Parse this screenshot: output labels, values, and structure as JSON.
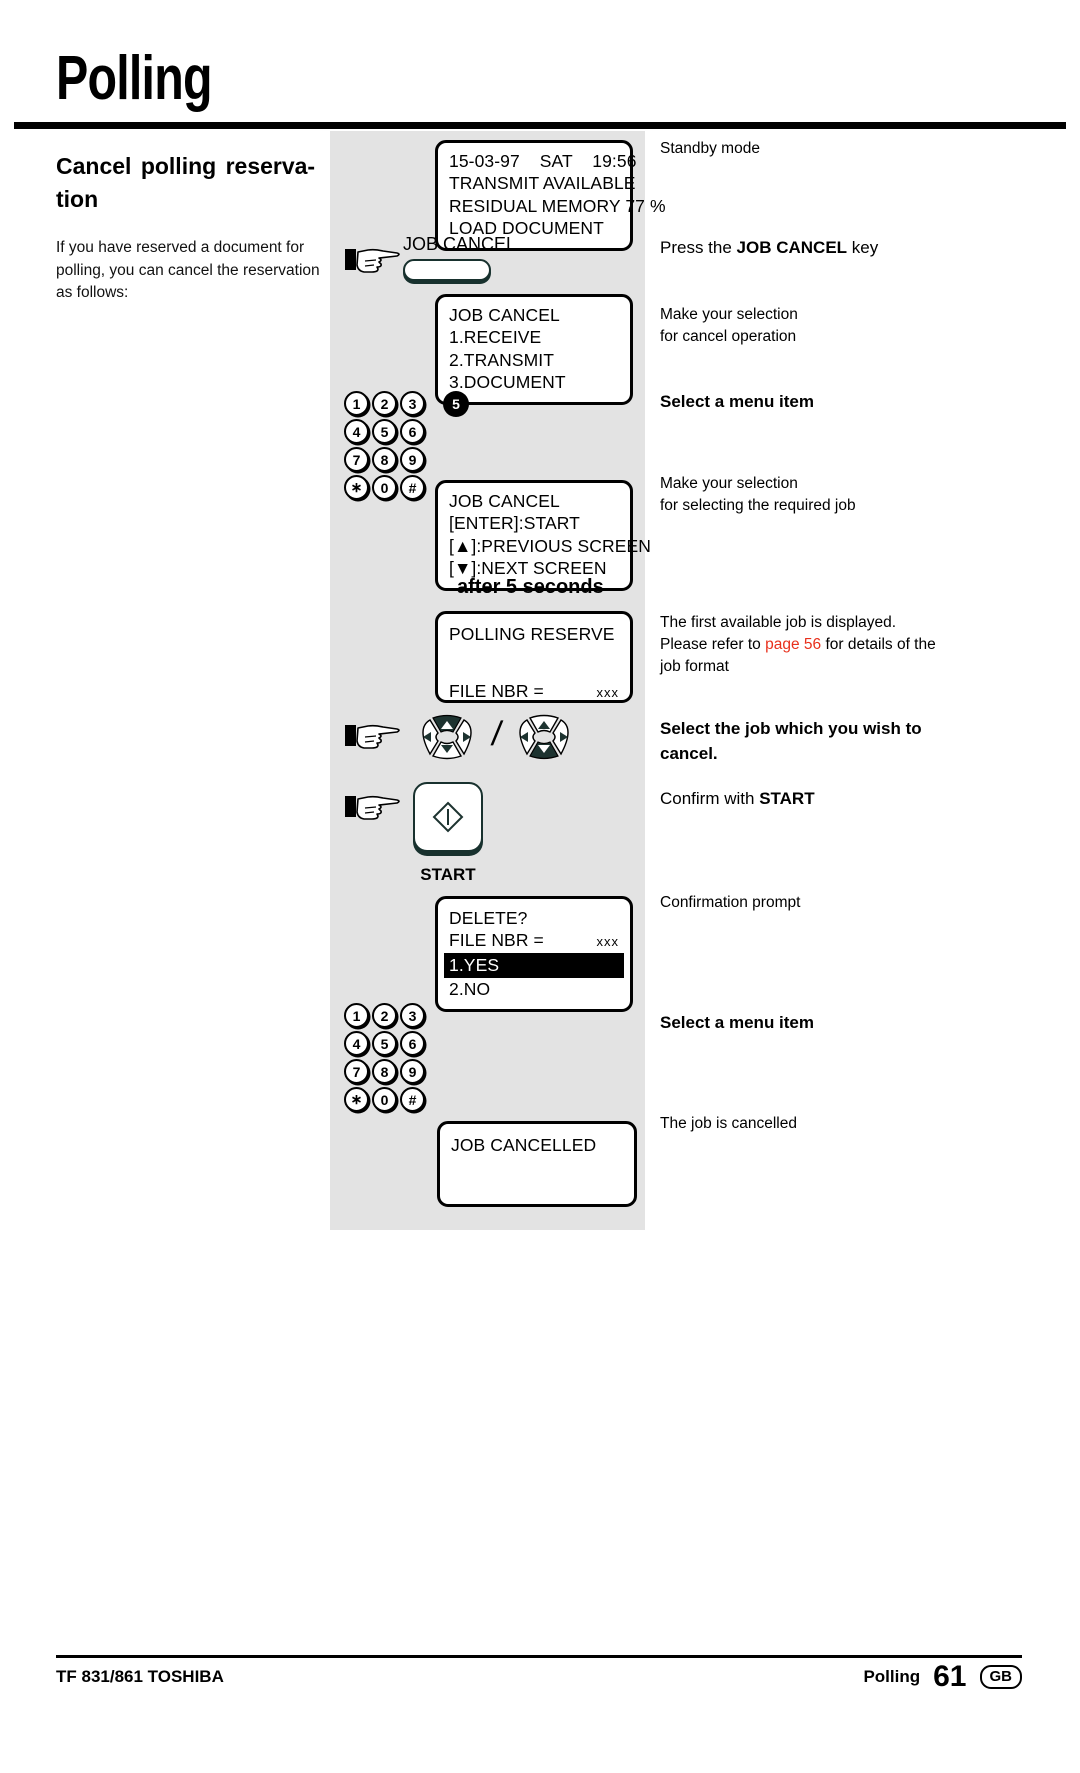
{
  "title": "Polling",
  "left": {
    "heading": "Cancel polling reserva-tion",
    "body": "If you have reserved a document for polling, you can cancel the reservation as follows:"
  },
  "displays": {
    "standby": {
      "l1": "15-03-97    SAT    19:56",
      "l2": "TRANSMIT AVAILABLE",
      "l3": "RESIDUAL MEMORY 77 %",
      "l4": "LOAD DOCUMENT"
    },
    "job_cancel_menu": {
      "l1": "JOB CANCEL",
      "l2": "1.RECEIVE",
      "l3": "2.TRANSMIT",
      "l4": "3.DOCUMENT"
    },
    "job_cancel_nav": {
      "l1": "JOB CANCEL",
      "l2": "[ENTER]:START",
      "l3": "[▲]:PREVIOUS SCREEN",
      "l4": "[▼]:NEXT SCREEN"
    },
    "polling_reserve": {
      "l1": "POLLING RESERVE",
      "file_label": "FILE NBR =",
      "file_value": "xxx"
    },
    "delete_prompt": {
      "l1": "DELETE?",
      "file_label": "FILE NBR =",
      "file_value": "xxx",
      "opt1": "1.YES",
      "opt2": "2.NO"
    },
    "job_cancelled": {
      "l1": "JOB CANCELLED"
    }
  },
  "controls": {
    "job_cancel_key_label": "JOB CANCEL",
    "start_key_label": "START",
    "after_note": "after 5 seconds",
    "keypad_rows": [
      [
        "1",
        "2",
        "3"
      ],
      [
        "4",
        "5",
        "6"
      ],
      [
        "7",
        "8",
        "9"
      ],
      [
        "∗",
        "0",
        "#"
      ]
    ],
    "highlight_key": "5"
  },
  "annotations": {
    "standby_mode": "Standby mode",
    "press_job_cancel_pre": "Press the ",
    "press_job_cancel_key": "JOB CANCEL",
    "press_job_cancel_post": " key",
    "make_selection_cancel": "Make your selection\nfor cancel operation",
    "select_menu_item_1": "Select a menu item",
    "make_selection_job": "Make your selection\nfor selecting the required job",
    "first_job_l1": "The first available job is displayed.",
    "first_job_l2_pre": "Please refer to ",
    "first_job_link": "page 56",
    "first_job_l2_post": " for details of the",
    "first_job_l3": "job format",
    "select_job": "Select the job which you wish to cancel.",
    "confirm_start_pre": "Confirm with ",
    "confirm_start_key": "START",
    "confirmation_prompt": "Confirmation prompt",
    "select_menu_item_2": "Select a menu item",
    "job_is_cancelled": "The job is cancelled"
  },
  "footer": {
    "left": "TF 831/861 TOSHIBA",
    "chapter": "Polling",
    "page": "61",
    "region": "GB"
  },
  "colors": {
    "panel_bg": "#e3e3e3",
    "link": "#e8301c",
    "key_shadow": "#18312e"
  }
}
